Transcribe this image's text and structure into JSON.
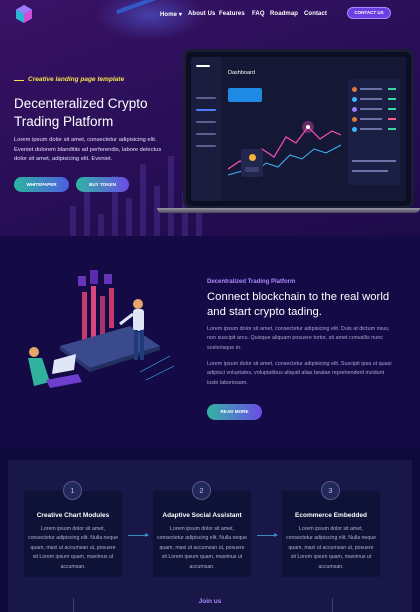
{
  "nav": {
    "items": [
      "Home",
      "About Us",
      "Features",
      "FAQ",
      "Roadmap",
      "Contact"
    ],
    "cta": "CONTACT US"
  },
  "hero": {
    "tagline": "Creative landing page template",
    "title": "Decenteralized Crypto Trading Platform",
    "lead": "Lorem ipsum dolor sit amet, consectetur adipisicing elit. Eveniet dolorem blanditiis ad perferendis, labore delectus dolor sit amet, adipisicing elit. Eveniet.",
    "btn_whitepaper": "WHITEPAPER",
    "btn_buy": "BUY TOKEN",
    "dashboard_title": "Dashboard"
  },
  "about": {
    "tag": "Decentralized Trading Platform",
    "title": "Connect blockchain to the real world and start crypto tading.",
    "p1": "Lorem ipsum dolor sit amet, consectetur adipisicing elit. Duis at dictum risus, non suscipit arcu. Quisque aliquam posuere tortor, sit amet convallis nunc scelerisque in.",
    "p2": "Lorem ipsum dolor sit amet, consectetur adipisicing elit. Suscipit ipsa ut quasi adipisci voluptates, voluptatibus aliquid alias beatae reprehenderit incidunt iusto laboriosam.",
    "read_more": "READ MORE"
  },
  "features": [
    {
      "num": "1",
      "title": "Creative Chart Modules",
      "desc": "Lorem ipsum dolor sit amet, consectetur adipiscing elit. Nulla neque quam, maxi ut accumsan ut, posuere sit Lorem ipsum quam, maximus ut accumsan."
    },
    {
      "num": "2",
      "title": "Adaptive Social Assistant",
      "desc": "Lorem ipsum dolor sit amet, consectetur adipiscing elit. Nulla neque quam, maxi ut accumsan ut, posuere sit Lorem ipsum quam, maximus ut accumsan."
    },
    {
      "num": "3",
      "title": "Ecommerce Embedded",
      "desc": "Lorem ipsum dolor sit amet, consectetur adipiscing elit. Nulla neque quam, maxi ut accumsan ut, posuere sit Lorem ipsum quam, maximus ut accumsan."
    }
  ],
  "join": "Join us"
}
